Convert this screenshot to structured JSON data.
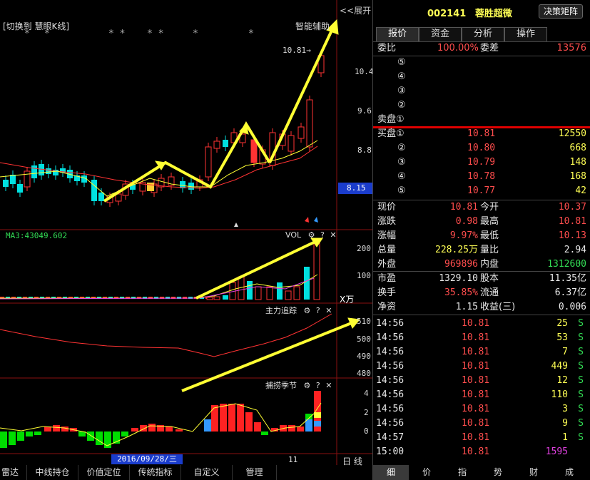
{
  "chart_header": {
    "switch_label": "[切换到 慧眼K线]",
    "smart_assist": "智能辅助",
    "expand": "<<展开",
    "stars": [
      "*",
      "*",
      "* *",
      "* *",
      "*",
      "*"
    ]
  },
  "price_axis": [
    "10.4",
    "9.6",
    "8.8"
  ],
  "price_marker": "8.15",
  "high_label": "10.81→",
  "vol_panel": {
    "ma_label": "MA3:43049.602",
    "name": "VOL",
    "unit": "X万",
    "ticks": [
      "200",
      "100"
    ]
  },
  "main_force_panel": {
    "name": "主力追踪",
    "ticks": [
      "510",
      "500",
      "490",
      "480"
    ]
  },
  "season_panel": {
    "name": "捕捞季节",
    "ticks": [
      "4",
      "2",
      "0"
    ]
  },
  "date_bar": {
    "date": "2016/09/28/三",
    "tick": "11",
    "mode": "日 线"
  },
  "bottom_tabs": [
    "雷达",
    "中线持仓",
    "价值定位",
    "传统指标",
    "自定义",
    "管理"
  ],
  "stock": {
    "code": "002141",
    "name": "蓉胜超微",
    "decision_button": "决策矩阵"
  },
  "tabs": [
    "报价",
    "资金",
    "分析",
    "操作"
  ],
  "weibi": {
    "label": "委比",
    "value": "100.00%",
    "label2": "委差",
    "value2": "13576"
  },
  "sell_levels": [
    "⑤",
    "④",
    "③",
    "②",
    "卖盘①"
  ],
  "buy_levels": [
    {
      "label": "买盘①",
      "price": "10.81",
      "vol": "12550"
    },
    {
      "label": "②",
      "price": "10.80",
      "vol": "668"
    },
    {
      "label": "③",
      "price": "10.79",
      "vol": "148"
    },
    {
      "label": "④",
      "price": "10.78",
      "vol": "168"
    },
    {
      "label": "⑤",
      "price": "10.77",
      "vol": "42"
    }
  ],
  "stats": [
    {
      "l1": "现价",
      "v1": "10.81",
      "l2": "今开",
      "v2": "10.37"
    },
    {
      "l1": "涨跌",
      "v1": "0.98",
      "l2": "最高",
      "v2": "10.81"
    },
    {
      "l1": "涨幅",
      "v1": "9.97%",
      "l2": "最低",
      "v2": "10.13"
    },
    {
      "l1": "总量",
      "v1": "228.25万",
      "l2": "量比",
      "v2": "2.94"
    },
    {
      "l1": "外盘",
      "v1": "969896",
      "l2": "内盘",
      "v2": "1312600"
    },
    {
      "l1": "市盈",
      "v1": "1329.10",
      "l2": "股本",
      "v2": "11.35亿"
    },
    {
      "l1": "换手",
      "v1": "35.85%",
      "l2": "流通",
      "v2": "6.37亿"
    },
    {
      "l1": "净资",
      "v1": "1.15",
      "l2": "收益(三)",
      "v2": "0.006"
    }
  ],
  "ticks": [
    {
      "time": "14:56",
      "price": "10.81",
      "vol": "25",
      "side": "S"
    },
    {
      "time": "14:56",
      "price": "10.81",
      "vol": "53",
      "side": "S"
    },
    {
      "time": "14:56",
      "price": "10.81",
      "vol": "7",
      "side": "S"
    },
    {
      "time": "14:56",
      "price": "10.81",
      "vol": "449",
      "side": "S"
    },
    {
      "time": "14:56",
      "price": "10.81",
      "vol": "12",
      "side": "S"
    },
    {
      "time": "14:56",
      "price": "10.81",
      "vol": "110",
      "side": "S"
    },
    {
      "time": "14:56",
      "price": "10.81",
      "vol": "3",
      "side": "S"
    },
    {
      "time": "14:56",
      "price": "10.81",
      "vol": "9",
      "side": "S"
    },
    {
      "time": "14:57",
      "price": "10.81",
      "vol": "1",
      "side": "S"
    },
    {
      "time": "15:00",
      "price": "10.81",
      "vol": "1595",
      "side": ""
    }
  ],
  "right_tabs": [
    "细",
    "价",
    "指",
    "势",
    "财",
    "成"
  ],
  "colors": {
    "up": "#ff3333",
    "down": "#00e0e0",
    "arrow": "#ffff33",
    "ma_yellow": "#ffff33",
    "ma_red": "#ff3333"
  }
}
